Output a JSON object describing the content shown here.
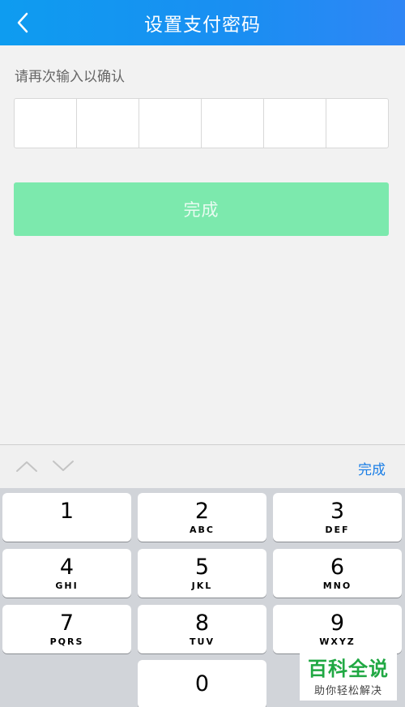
{
  "header": {
    "title": "设置支付密码",
    "back_icon": "chevron-left-icon"
  },
  "form": {
    "prompt": "请再次输入以确认",
    "pin_length": 6,
    "done_button": "完成",
    "done_button_color": "#7ce9ad"
  },
  "keyboard_toolbar": {
    "prev_icon": "chevron-up-icon",
    "next_icon": "chevron-down-icon",
    "done": "完成",
    "done_color": "#1a7ee6"
  },
  "keypad": {
    "keys": [
      {
        "num": "1",
        "letters": ""
      },
      {
        "num": "2",
        "letters": "ABC"
      },
      {
        "num": "3",
        "letters": "DEF"
      },
      {
        "num": "4",
        "letters": "GHI"
      },
      {
        "num": "5",
        "letters": "JKL"
      },
      {
        "num": "6",
        "letters": "MNO"
      },
      {
        "num": "7",
        "letters": "PQRS"
      },
      {
        "num": "8",
        "letters": "TUV"
      },
      {
        "num": "9",
        "letters": "WXYZ"
      },
      {
        "num": "0",
        "letters": ""
      }
    ]
  },
  "watermark": {
    "main": "百科全说",
    "sub": "助你轻松解决"
  }
}
